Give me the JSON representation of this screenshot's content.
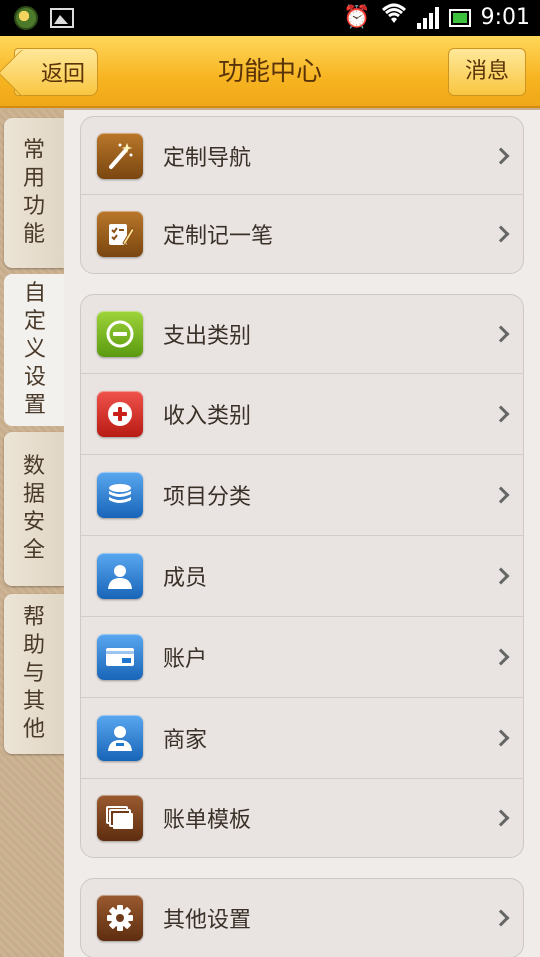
{
  "status_bar": {
    "time": "9:01",
    "icons": [
      "app-notification-icon",
      "image-notification-icon",
      "alarm-icon",
      "wifi-icon",
      "signal-icon",
      "battery-icon"
    ]
  },
  "header": {
    "back_label": "返回",
    "title": "功能中心",
    "message_label": "消息"
  },
  "sidebar": {
    "tabs": [
      {
        "label": "常用功能",
        "chars": [
          "常",
          "用",
          "功",
          "能"
        ],
        "active": false
      },
      {
        "label": "自定义设置",
        "chars": [
          "自",
          "定",
          "义",
          "设",
          "置"
        ],
        "active": true
      },
      {
        "label": "数据安全",
        "chars": [
          "数",
          "据",
          "安",
          "全"
        ],
        "active": false
      },
      {
        "label": "帮助与其他",
        "chars": [
          "帮",
          "助",
          "与",
          "其",
          "他"
        ],
        "active": false
      }
    ]
  },
  "groups": [
    {
      "items": [
        {
          "label": "定制导航",
          "icon": "magic-wand-icon",
          "color": "#9a5a1c"
        },
        {
          "label": "定制记一笔",
          "icon": "checklist-edit-icon",
          "color": "#9a5a1c"
        }
      ]
    },
    {
      "items": [
        {
          "label": "支出类别",
          "icon": "minus-circle-icon",
          "color": "#6aa81a"
        },
        {
          "label": "收入类别",
          "icon": "plus-circle-icon",
          "color": "#d0261e"
        },
        {
          "label": "项目分类",
          "icon": "stack-icon",
          "color": "#1e78d0"
        },
        {
          "label": "成员",
          "icon": "person-icon",
          "color": "#1e78d0"
        },
        {
          "label": "账户",
          "icon": "card-icon",
          "color": "#1e78d0"
        },
        {
          "label": "商家",
          "icon": "merchant-icon",
          "color": "#1e78d0"
        },
        {
          "label": "账单模板",
          "icon": "template-icon",
          "color": "#6e3a18"
        }
      ]
    },
    {
      "items": [
        {
          "label": "其他设置",
          "icon": "gear-icon",
          "color": "#6e3a18"
        }
      ]
    }
  ],
  "colors": {
    "header_gradient_top": "#ffd75a",
    "header_gradient_bottom": "#f0a818",
    "accent_text": "#5a3408"
  }
}
